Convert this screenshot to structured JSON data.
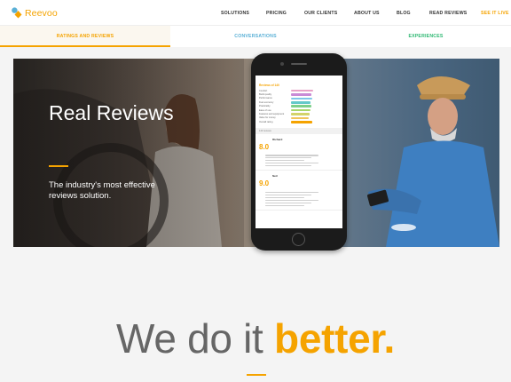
{
  "brand": {
    "name": "Reevoo",
    "accent": "#f5a300"
  },
  "nav": {
    "items": [
      "SOLUTIONS",
      "PRICING",
      "OUR CLIENTS",
      "ABOUT US",
      "BLOG",
      "READ REVIEWS"
    ],
    "cta": "SEE IT LIVE"
  },
  "tabs": [
    {
      "label": "RATINGS AND REVIEWS",
      "color": "#f5a300"
    },
    {
      "label": "CONVERSATIONS",
      "color": "#5ab0d6"
    },
    {
      "label": "EXPERIENCES",
      "color": "#2eb872"
    }
  ],
  "hero": {
    "title": "Real Reviews",
    "subtitle": "The industry's most effective reviews solution."
  },
  "phone_screen": {
    "header": "Reviews of 140",
    "ratings": [
      {
        "label": "Comfort",
        "value": 0.82,
        "color": "#e7a1c7"
      },
      {
        "label": "Build quality",
        "value": 0.78,
        "color": "#c98bd6"
      },
      {
        "label": "Performance",
        "value": 0.8,
        "color": "#7fc6e8"
      },
      {
        "label": "Fuel economy",
        "value": 0.74,
        "color": "#64c9c9"
      },
      {
        "label": "Practicality",
        "value": 0.76,
        "color": "#7dd08a"
      },
      {
        "label": "Ease of use",
        "value": 0.72,
        "color": "#a8d66b"
      },
      {
        "label": "Features and equipment",
        "value": 0.7,
        "color": "#d3d36a"
      },
      {
        "label": "Value for money",
        "value": 0.68,
        "color": "#f0c45a"
      },
      {
        "label": "Overall rating",
        "value": 0.8,
        "color": "#f5a300"
      }
    ],
    "count_label": "140 reviews",
    "reviews": [
      {
        "score": "8.0",
        "name": "Richard",
        "lines": 5
      },
      {
        "score": "9.0",
        "name": "Neil",
        "lines": 6
      }
    ]
  },
  "tagline": {
    "plain": "We do it ",
    "bold": "better."
  }
}
